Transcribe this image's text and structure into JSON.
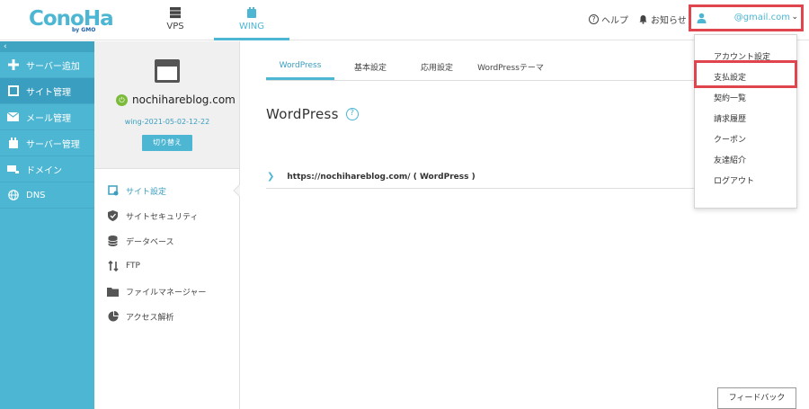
{
  "brand": {
    "name": "ConoHa",
    "sub": "by GMO"
  },
  "top_tabs": [
    {
      "label": "VPS",
      "icon": "server-icon"
    },
    {
      "label": "WING",
      "icon": "wing-icon"
    }
  ],
  "header": {
    "help": "ヘルプ",
    "notice": "お知らせ",
    "account_email": "@gmail.com"
  },
  "leftnav": {
    "items": [
      {
        "label": "サーバー追加",
        "icon": "plus-icon"
      },
      {
        "label": "サイト管理",
        "icon": "site-icon"
      },
      {
        "label": "メール管理",
        "icon": "mail-icon"
      },
      {
        "label": "サーバー管理",
        "icon": "server-icon"
      },
      {
        "label": "ドメイン",
        "icon": "domain-icon"
      },
      {
        "label": "DNS",
        "icon": "globe-icon"
      }
    ]
  },
  "site": {
    "name": "nochihareblog.com",
    "wing_id": "wing-2021-05-02-12-22",
    "switch_label": "切り替え",
    "menu": [
      {
        "label": "サイト設定",
        "icon": "site-settings-icon"
      },
      {
        "label": "サイトセキュリティ",
        "icon": "shield-icon"
      },
      {
        "label": "データベース",
        "icon": "database-icon"
      },
      {
        "label": "FTP",
        "icon": "transfer-icon"
      },
      {
        "label": "ファイルマネージャー",
        "icon": "folder-icon"
      },
      {
        "label": "アクセス解析",
        "icon": "pie-chart-icon"
      }
    ]
  },
  "main": {
    "tabs": [
      "WordPress",
      "基本設定",
      "応用設定",
      "WordPressテーマ"
    ],
    "title": "WordPress",
    "wp_row": "https://nochihareblog.com/ ( WordPress )"
  },
  "dropdown": {
    "items": [
      "アカウント設定",
      "支払設定",
      "契約一覧",
      "請求履歴",
      "クーポン",
      "友達紹介",
      "ログアウト"
    ]
  },
  "feedback_label": "フィードバック",
  "colors": {
    "accent": "#4db6d3",
    "highlight": "#e0454d",
    "power": "#7cbb3a"
  }
}
